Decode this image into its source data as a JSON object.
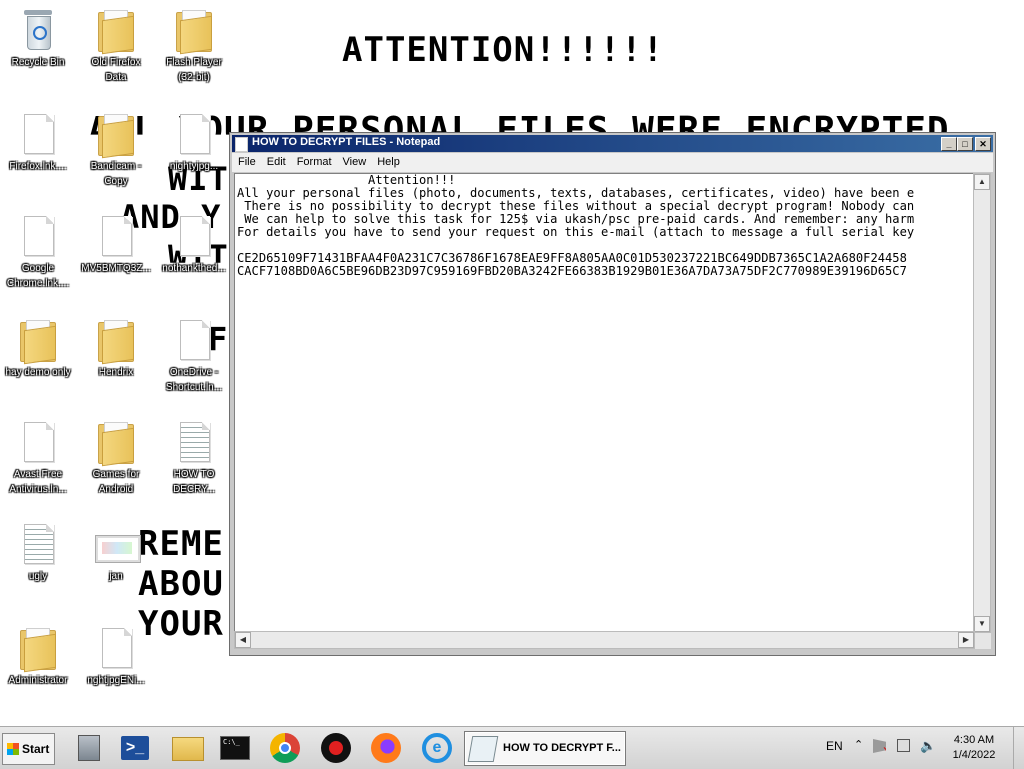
{
  "wallpaper": {
    "attention": "ATTENTION!!!!!!",
    "line1": "ALL YOUR PERSONAL FILES WERE ENCRYPTED",
    "line2": "WITH",
    "line3": "AND Y",
    "line4": "WITH",
    "line5": "F",
    "remember1": "REME",
    "remember2": "ABOU",
    "remember3": "YOUR"
  },
  "desktop_icons": [
    {
      "label1": "Recycle Bin",
      "label2": "",
      "type": "bin"
    },
    {
      "label1": "Old Firefox",
      "label2": "Data",
      "type": "folder"
    },
    {
      "label1": "Flash Player",
      "label2": "(32-bit)",
      "type": "folder"
    },
    {
      "label1": "Firefox.lnk....",
      "label2": "",
      "type": "doc"
    },
    {
      "label1": "Bandicam -",
      "label2": "Copy",
      "type": "folder"
    },
    {
      "label1": "nightyjpg...",
      "label2": "",
      "type": "doc"
    },
    {
      "label1": "Google",
      "label2": "Chrome.lnk....",
      "type": "doc"
    },
    {
      "label1": "MV5BMTQ3Z...",
      "label2": "",
      "type": "doc"
    },
    {
      "label1": "nothankthed...",
      "label2": "",
      "type": "doc"
    },
    {
      "label1": "hay demo only",
      "label2": "",
      "type": "folder"
    },
    {
      "label1": "Hendrix",
      "label2": "",
      "type": "folder"
    },
    {
      "label1": "OneDrive -",
      "label2": "Shortcut.ln...",
      "type": "doc"
    },
    {
      "label1": "Avast Free",
      "label2": "Antivirus.ln...",
      "type": "doc"
    },
    {
      "label1": "Games for",
      "label2": "Android",
      "type": "folder"
    },
    {
      "label1": "HOW TO",
      "label2": "DECRY...",
      "type": "doclined"
    },
    {
      "label1": "ugly",
      "label2": "",
      "type": "doclined"
    },
    {
      "label1": "jan",
      "label2": "",
      "type": "pic"
    },
    {
      "label1": "Administrator",
      "label2": "",
      "type": "folder"
    },
    {
      "label1": "nghtjpgENi...",
      "label2": "",
      "type": "doc"
    }
  ],
  "notepad": {
    "title": "HOW TO DECRYPT FILES - Notepad",
    "menu": [
      "File",
      "Edit",
      "Format",
      "View",
      "Help"
    ],
    "content": "                  Attention!!!\nAll your personal files (photo, documents, texts, databases, certificates, video) have been e\n There is no possibility to decrypt these files without a special decrypt program! Nobody can\n We can help to solve this task for 125$ via ukash/psc pre-paid cards. And remember: any harm\nFor details you have to send your request on this e-mail (attach to message a full serial key\n\nCE2D65109F71431BFAA4F0A231C7C36786F1678EAE9FF8A805AA0C01D530237221BC649DDB7365C1A2A680F24458\nCACF7108BD0A6C5BE96DB23D97C959169FBD20BA3242FE66383B1929B01E36A7DA73A75DF2C770989E39196D65C7"
  },
  "taskbar": {
    "start_label": "Start",
    "active_window": "HOW TO DECRYPT F...",
    "language": "EN",
    "time": "4:30 AM",
    "date": "1/4/2022"
  }
}
